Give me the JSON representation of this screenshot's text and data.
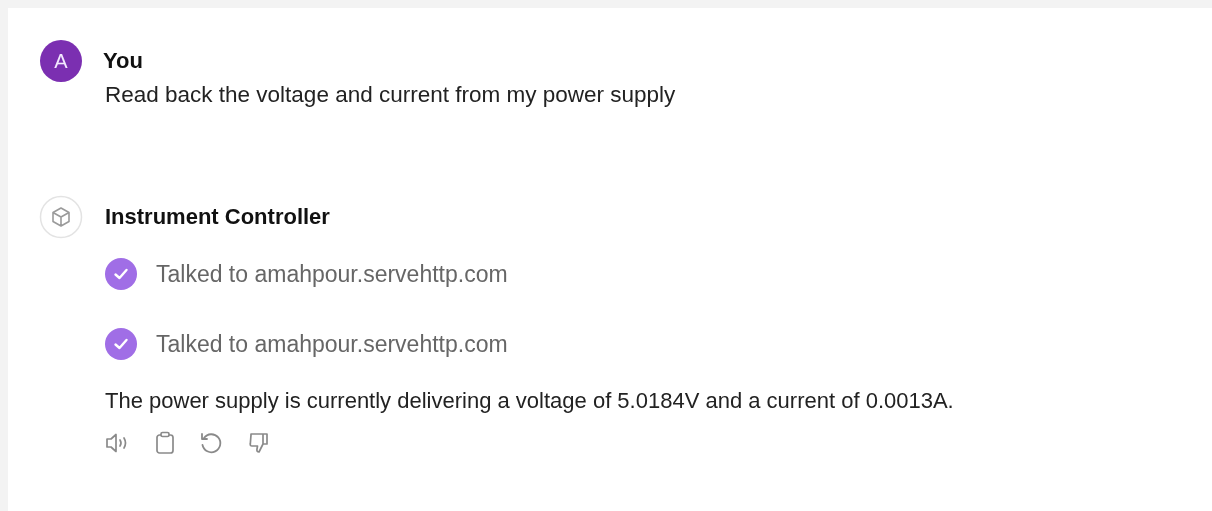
{
  "user": {
    "avatar": "A",
    "name": "You",
    "message": "Read back the voltage and current from my power supply"
  },
  "assistant": {
    "name": "Instrument Controller",
    "steps": [
      {
        "text": "Talked to amahpour.servehttp.com",
        "done": true
      },
      {
        "text": "Talked to amahpour.servehttp.com",
        "done": true
      }
    ],
    "response": "The power supply is currently delivering a voltage of 5.0184V and a current of 0.0013A."
  }
}
